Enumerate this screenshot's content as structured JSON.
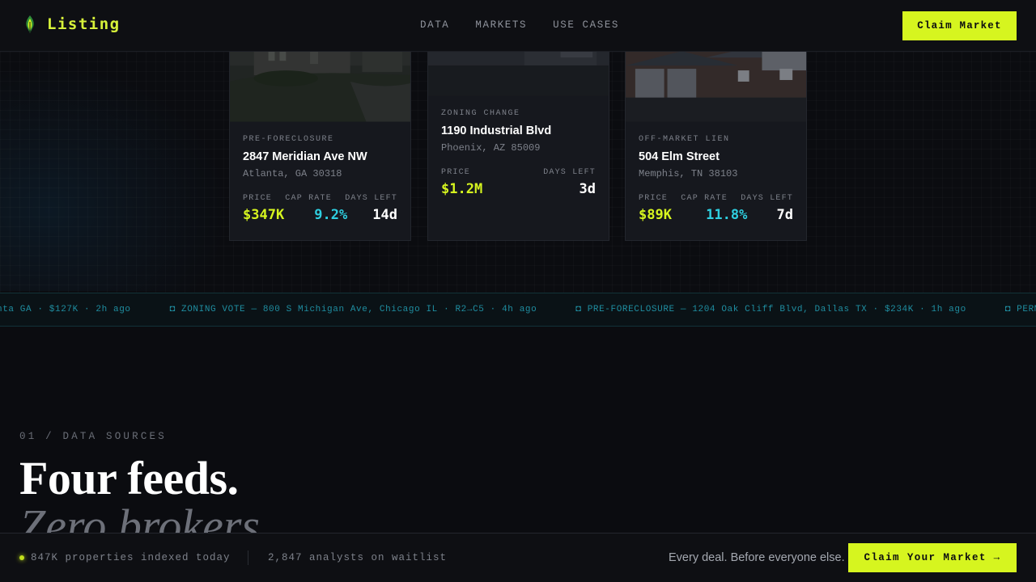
{
  "brand": {
    "name": "Listing",
    "icon": "leaf-flame-icon",
    "accent": "#d6f51f"
  },
  "nav": {
    "links": [
      "DATA",
      "MARKETS",
      "USE CASES"
    ],
    "cta": "Claim Market"
  },
  "cards": [
    {
      "tag": "PRE-FORECLOSURE",
      "address": "2847 Meridian Ave NW",
      "city": "Atlanta, GA 30318",
      "labels": {
        "price": "PRICE",
        "cap": "CAP RATE",
        "days": "DAYS LEFT"
      },
      "price": "$347K",
      "cap_rate": "9.2%",
      "days_left": "14d"
    },
    {
      "tag": "ZONING CHANGE",
      "address": "1190 Industrial Blvd",
      "city": "Phoenix, AZ 85009",
      "labels": {
        "price": "PRICE",
        "days": "DAYS LEFT"
      },
      "price": "$1.2M",
      "days_left": "3d"
    },
    {
      "tag": "OFF-MARKET LIEN",
      "address": "504 Elm Street",
      "city": "Memphis, TN 38103",
      "labels": {
        "price": "PRICE",
        "cap": "CAP RATE",
        "days": "DAYS LEFT"
      },
      "price": "$89K",
      "cap_rate": "11.8%",
      "days_left": "7d"
    }
  ],
  "ticker": [
    "nta GA · $127K · 2h ago",
    "◘ ZONING VOTE — 800 S Michigan Ave, Chicago IL · R2→C5 · 4h ago",
    "◘ PRE-FORECLOSURE — 1204 Oak Cliff Blvd, Dallas TX · $234K · 1h ago",
    "◘ PERM"
  ],
  "section": {
    "label": "01 / DATA SOURCES",
    "heading": "Four feeds.",
    "subheading": "Zero brokers."
  },
  "footer": {
    "indexed": "847K properties indexed today",
    "waitlist": "2,847 analysts on waitlist",
    "tagline": "Every deal. Before everyone else.",
    "cta": "Claim Your Market →"
  }
}
